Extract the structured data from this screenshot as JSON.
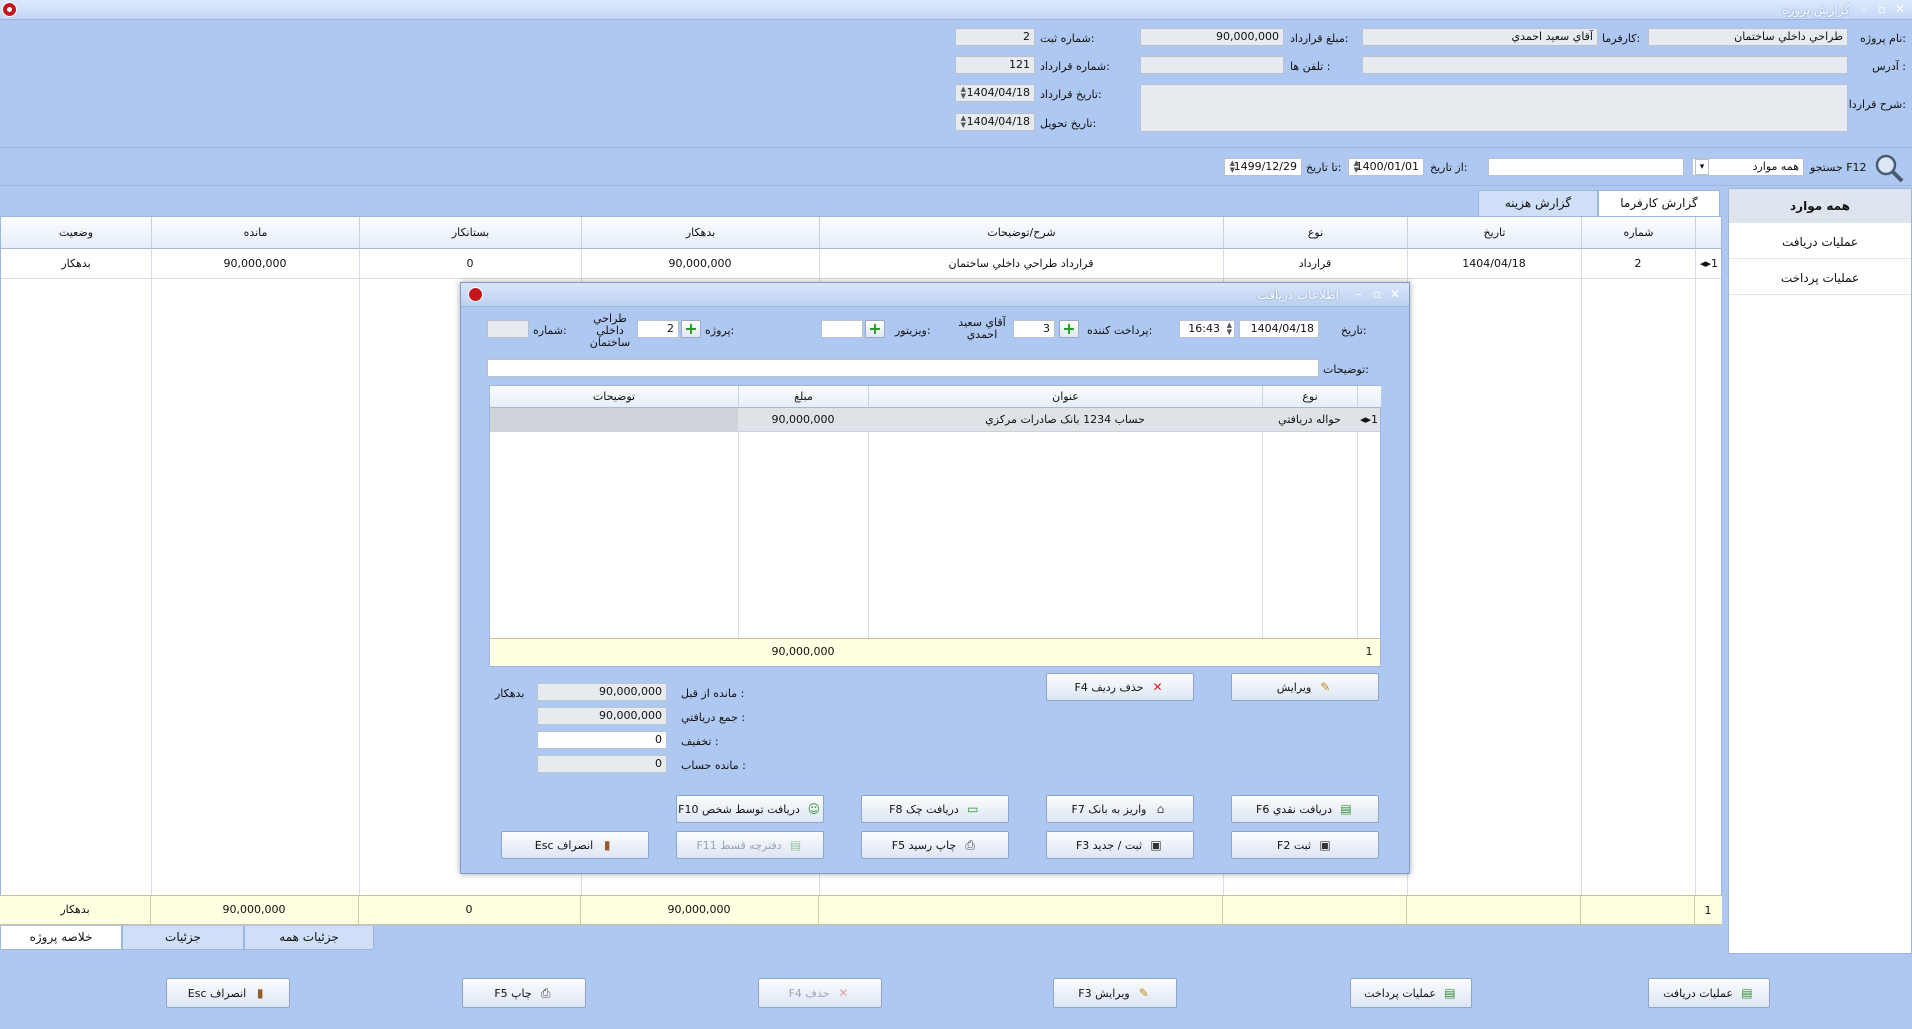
{
  "window": {
    "title": "گزارش پروژه"
  },
  "header": {
    "project_name_label": "نام پروژه:",
    "project_name": "طراحي داخلي ساختمان",
    "employer_label": "کارفرما:",
    "employer": "آقاي سعيد احمدي",
    "contract_amount_label": "مبلغ قرارداد:",
    "contract_amount": "90,000,000",
    "reg_number_label": "شماره ثبت:",
    "reg_number": "2",
    "address_label": "آدرس :",
    "address": "",
    "phones_label": "تلفن ها :",
    "phones": "",
    "contract_number_label": "شماره قرارداد:",
    "contract_number": "121",
    "contract_desc_label": "شرح قرارداد:",
    "contract_date_label": "تاريخ قرارداد:",
    "contract_date": "1404/04/18",
    "delivery_date_label": "تاريخ تحويل:",
    "delivery_date": "1404/04/18"
  },
  "search": {
    "label": "جستجو F12",
    "filter_value": "همه موارد",
    "text": "",
    "from_label": "از تاريخ:",
    "from_date": "1400/01/01",
    "to_label": "تا تاريخ:",
    "to_date": "1499/12/29"
  },
  "sidebar": {
    "items": [
      {
        "label": "همه موارد"
      },
      {
        "label": "عمليات دريافت"
      },
      {
        "label": "عمليات پرداخت"
      }
    ]
  },
  "tabs_top": [
    "گزارش کارفرما",
    "گزارش هزينه"
  ],
  "grid": {
    "columns": [
      "شماره",
      "تاريخ",
      "نوع",
      "شرح/توضيحات",
      "بدهکار",
      "بستانکار",
      "مانده",
      "وضعيت"
    ],
    "rows": [
      {
        "index": "1",
        "number": "2",
        "date": "1404/04/18",
        "type": "قرارداد",
        "description": "قرارداد طراحي داخلي ساختمان",
        "debit": "90,000,000",
        "credit": "0",
        "balance": "90,000,000",
        "status": "بدهکار"
      }
    ],
    "footer": {
      "index": "1",
      "debit": "90,000,000",
      "credit": "0",
      "balance": "90,000,000",
      "status": "بدهکار"
    }
  },
  "tabs_bottom": [
    "خلاصه پروژه",
    "جزئيات",
    "جزئيات همه"
  ],
  "bottom_buttons": {
    "receive": "عمليات دريافت",
    "pay": "عمليات پرداخت",
    "edit": "ويرايش F3",
    "delete": "حذف F4",
    "print": "چاپ F5",
    "cancel": "انصراف Esc"
  },
  "dialog": {
    "title": "اطلاعات دريافت",
    "date_label": "تاريخ:",
    "date": "1404/04/18",
    "time": "16:43",
    "payer_label": "پرداخت کننده:",
    "payer_id": "3",
    "payer_name": "آقاي سعيد احمدي",
    "visitor_label": "ويزيتور:",
    "visitor": "",
    "project_label": "پروژه:",
    "project_id": "2",
    "project_name": "طراحي داخلي ساختمان",
    "number_label": "شماره:",
    "number": "",
    "desc_label": "توضيحات:",
    "desc": "",
    "grid_columns": [
      "نوع",
      "عنوان",
      "مبلغ",
      "توضيحات"
    ],
    "grid_rows": [
      {
        "index": "1",
        "type": "حواله دريافتي",
        "title": "حساب 1234 بانک صادرات مرکزي",
        "amount": "90,000,000",
        "desc": ""
      }
    ],
    "grid_footer": {
      "index": "1",
      "amount": "90,000,000"
    },
    "prev_balance_label": "مانده از قبل :",
    "prev_balance": "90,000,000",
    "prev_balance_status": "بدهکار",
    "total_label": "جمع دريافتي :",
    "total": "90,000,000",
    "discount_label": "تخفيف :",
    "discount": "0",
    "account_balance_label": "مانده حساب :",
    "account_balance": "0",
    "buttons": {
      "edit": "ويرايش",
      "delete_row": "حذف رديف F4",
      "cash": "دريافت نقدي F6",
      "bank": "واريز به بانک F7",
      "cheque": "دريافت چک F8",
      "person": "دريافت توسط شخص F10",
      "save": "ثبت F2",
      "save_new": "ثبت / جديد F3",
      "print_receipt": "چاپ رسيد F5",
      "installments": "دفترچه قسط F11",
      "cancel": "انصراف Esc"
    }
  }
}
